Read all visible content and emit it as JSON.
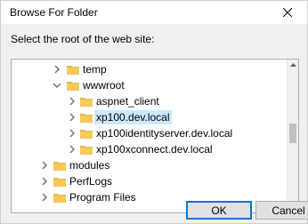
{
  "window": {
    "title": "Browse For Folder",
    "close_icon": "close-icon"
  },
  "prompt": "Select the root of the web site:",
  "tree": {
    "items": [
      {
        "label": "temp",
        "expanded": false,
        "selected": false,
        "icon": "folder-icon"
      },
      {
        "label": "wwwroot",
        "expanded": true,
        "selected": false,
        "icon": "folder-icon"
      },
      {
        "label": "aspnet_client",
        "expanded": false,
        "selected": false,
        "icon": "folder-icon"
      },
      {
        "label": "xp100.dev.local",
        "expanded": false,
        "selected": true,
        "icon": "folder-icon"
      },
      {
        "label": "xp100identityserver.dev.local",
        "expanded": false,
        "selected": false,
        "icon": "folder-icon"
      },
      {
        "label": "xp100xconnect.dev.local",
        "expanded": false,
        "selected": false,
        "icon": "folder-icon"
      },
      {
        "label": "modules",
        "expanded": false,
        "selected": false,
        "icon": "folder-icon"
      },
      {
        "label": "PerfLogs",
        "expanded": false,
        "selected": false,
        "icon": "folder-icon"
      },
      {
        "label": "Program Files",
        "expanded": false,
        "selected": false,
        "icon": "folder-icon"
      }
    ]
  },
  "buttons": {
    "ok": "OK",
    "cancel": "Cancel"
  },
  "colors": {
    "selection": "#cce8ff",
    "folder": "#e8b84a",
    "accent": "#0078d7"
  }
}
